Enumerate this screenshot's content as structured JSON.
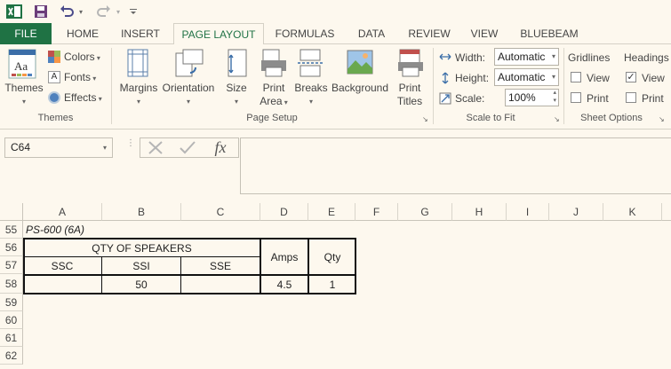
{
  "title_bar": {
    "app_icon": "excel-icon",
    "save_icon": "save-icon",
    "undo_icon": "undo-icon",
    "redo_icon": "redo-icon",
    "customize_icon": "customize-qat-icon"
  },
  "tabs": [
    {
      "label": "FILE"
    },
    {
      "label": "HOME"
    },
    {
      "label": "INSERT"
    },
    {
      "label": "PAGE LAYOUT"
    },
    {
      "label": "FORMULAS"
    },
    {
      "label": "DATA"
    },
    {
      "label": "REVIEW"
    },
    {
      "label": "VIEW"
    },
    {
      "label": "BLUEBEAM"
    }
  ],
  "ribbon": {
    "themes_group": {
      "label": "Themes",
      "themes_button": "Themes",
      "colors": "Colors",
      "fonts": "Fonts",
      "effects": "Effects"
    },
    "page_setup_group": {
      "label": "Page Setup",
      "margins": "Margins",
      "orientation": "Orientation",
      "size": "Size",
      "print_area_1": "Print",
      "print_area_2": "Area",
      "breaks": "Breaks",
      "background": "Background",
      "print_titles_1": "Print",
      "print_titles_2": "Titles"
    },
    "scale_group": {
      "label": "Scale to Fit",
      "width_label": "Width:",
      "width_value": "Automatic",
      "height_label": "Height:",
      "height_value": "Automatic",
      "scale_label": "Scale:",
      "scale_value": "100%"
    },
    "sheet_options_group": {
      "label": "Sheet Options",
      "gridlines": "Gridlines",
      "headings": "Headings",
      "gridlines_view": "View",
      "gridlines_print": "Print",
      "headings_view": "View",
      "headings_print": "Print",
      "gridlines_view_checked": false,
      "gridlines_print_checked": false,
      "headings_view_checked": true,
      "headings_print_checked": false
    }
  },
  "formula_bar": {
    "name_box": "C64",
    "cancel_icon": "cancel-icon",
    "enter_icon": "enter-icon",
    "fx": "fx",
    "formula": ""
  },
  "grid": {
    "columns": [
      "A",
      "B",
      "C",
      "D",
      "E",
      "F",
      "G",
      "H",
      "I",
      "J",
      "K"
    ],
    "rows": [
      "55",
      "56",
      "57",
      "58",
      "59",
      "60",
      "61",
      "62"
    ],
    "cells": {
      "a55": "PS-600 (6A)",
      "qty_of_speakers": "QTY OF SPEAKERS",
      "amps": "Amps",
      "qty": "Qty",
      "ssc": "SSC",
      "ssi": "SSI",
      "sse": "SSE",
      "b58": "50",
      "d58": "4.5",
      "e58": "1"
    }
  },
  "colors": {
    "file_tab": "#1f7244",
    "active_tab_text": "#217346",
    "background": "#fdf8ee"
  }
}
